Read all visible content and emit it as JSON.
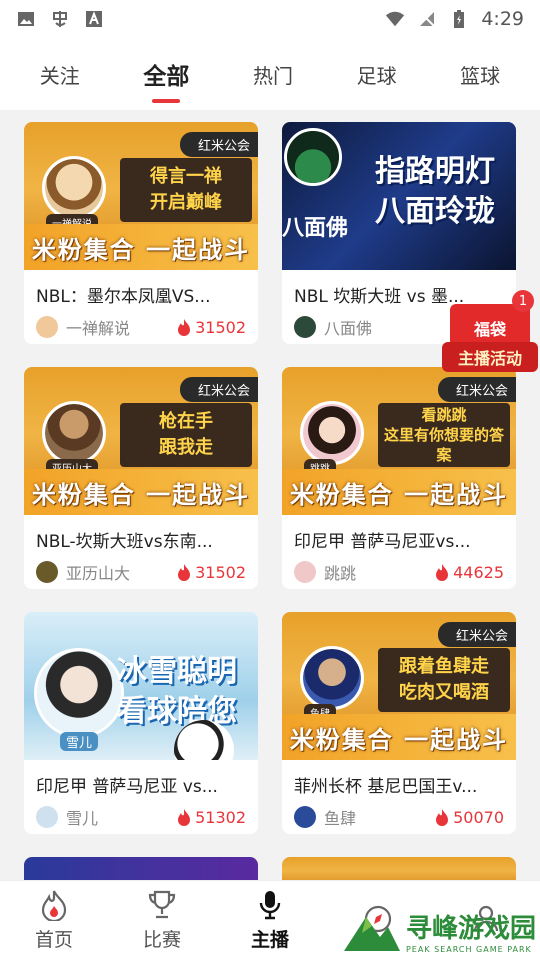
{
  "status_bar": {
    "time": "4:29"
  },
  "tabs": [
    {
      "label": "关注",
      "active": false
    },
    {
      "label": "全部",
      "active": true
    },
    {
      "label": "热门",
      "active": false
    },
    {
      "label": "足球",
      "active": false
    },
    {
      "label": "篮球",
      "active": false
    }
  ],
  "cards": [
    {
      "title": "NBL：墨尔本凤凰VS...",
      "host": "一禅解说",
      "heat": "31502",
      "thumb": {
        "style": "orange",
        "tag": "红米公会",
        "slogan_1": "得言一禅",
        "slogan_2": "开启巅峰",
        "host_label": "一禅解说",
        "banner": "米粉集合 一起战斗"
      }
    },
    {
      "title": "NBL     坎斯大班 vs 墨...",
      "host": "八面佛",
      "heat": "",
      "thumb": {
        "style": "dark",
        "big_1": "指路明灯",
        "big_2": "八面玲珑",
        "host_label": "八面佛"
      }
    },
    {
      "title": "NBL-坎斯大班vs东南...",
      "host": "亚历山大",
      "heat": "31502",
      "thumb": {
        "style": "orange",
        "tag": "红米公会",
        "slogan_1": "枪在手",
        "slogan_2": "跟我走",
        "host_label": "亚历山大",
        "banner": "米粉集合 一起战斗"
      }
    },
    {
      "title": "印尼甲 普萨马尼亚vs...",
      "host": "跳跳",
      "heat": "44625",
      "thumb": {
        "style": "orange",
        "tag": "红米公会",
        "slogan_1": "看跳跳",
        "slogan_2": "这里有你想要的答案",
        "host_label": "跳跳",
        "banner": "米粉集合 一起战斗"
      }
    },
    {
      "title": "印尼甲 普萨马尼亚 vs...",
      "host": "雪儿",
      "heat": "51302",
      "thumb": {
        "style": "ice",
        "big_1": "冰雪聪明",
        "big_2": "看球陪您",
        "host_label": "雪儿"
      }
    },
    {
      "title": "菲州长杯 基尼巴国王v...",
      "host": "鱼肆",
      "heat": "50070",
      "thumb": {
        "style": "orange",
        "tag": "红米公会",
        "slogan_1": "跟着鱼肆走",
        "slogan_2": "吃肉又喝酒",
        "host_label": "鱼肆",
        "banner": "米粉集合 一起战斗"
      }
    }
  ],
  "promo": {
    "badge": "1",
    "line1": "福袋",
    "line2": "主播活动"
  },
  "bottom_nav": [
    {
      "label": "首页",
      "active": false
    },
    {
      "label": "比赛",
      "active": false
    },
    {
      "label": "主播",
      "active": true
    },
    {
      "label": "",
      "active": false
    },
    {
      "label": "",
      "active": false
    }
  ],
  "watermark": {
    "text": "寻峰游戏园",
    "sub": "PEAK SEARCH GAME PARK"
  },
  "colors": {
    "accent": "#e8353a",
    "orange": "#f0b445"
  }
}
